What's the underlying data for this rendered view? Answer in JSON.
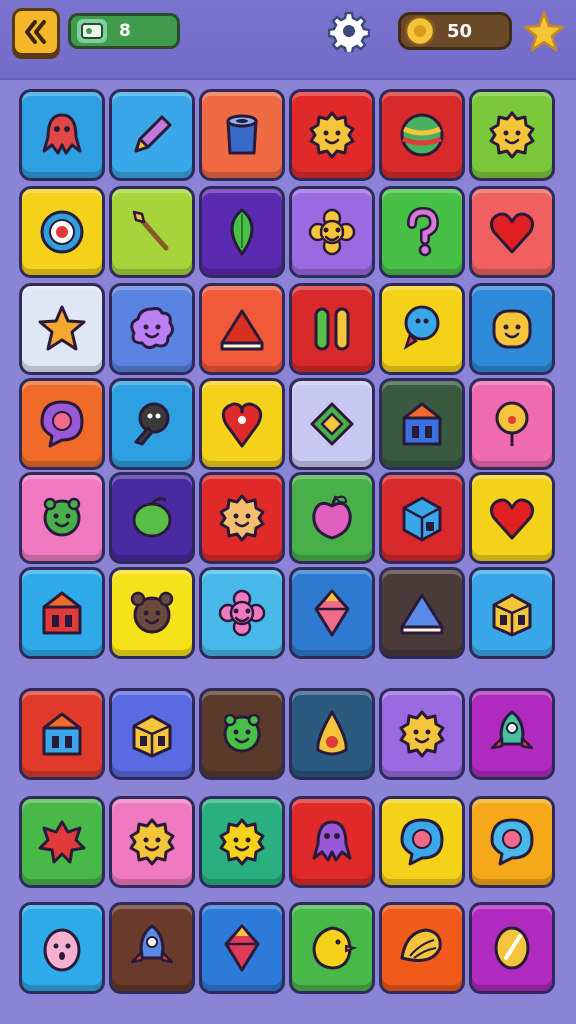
{
  "hud": {
    "xp_value": "8",
    "coins_value": "50",
    "colors": {
      "back": "#f4b72a",
      "xp": "#3f9a4a",
      "coins": "#6b4a2a",
      "accent": "#f4c43a"
    }
  },
  "board": {
    "rows": [
      [
        {
          "color": "#2e9fe0",
          "icon": "octopus-icon",
          "fg": "#e04848"
        },
        {
          "color": "#3aa8e8",
          "icon": "pencil-icon",
          "fg": "#c07ad8"
        },
        {
          "color": "#f06a44",
          "icon": "barrel-icon",
          "fg": "#3a6ac8"
        },
        {
          "color": "#e02a2a",
          "icon": "sun-face-icon",
          "fg": "#f4c43a"
        },
        {
          "color": "#d82a2a",
          "icon": "ball-icon",
          "fg": "#48b060"
        },
        {
          "color": "#7ac83a",
          "icon": "sun-face-icon",
          "fg": "#f4c43a"
        }
      ],
      [
        {
          "color": "#f4d21a",
          "icon": "target-icon",
          "fg": "#2e9fe0"
        },
        {
          "color": "#a6d43a",
          "icon": "brush-icon",
          "fg": "#8a5a2a"
        },
        {
          "color": "#5a2ab0",
          "icon": "leaf-icon",
          "fg": "#48c048"
        },
        {
          "color": "#9a6ae0",
          "icon": "flower-icon",
          "fg": "#f4c43a"
        },
        {
          "color": "#48c048",
          "icon": "question-icon",
          "fg": "#d878d8"
        },
        {
          "color": "#f06060",
          "icon": "heart-icon",
          "fg": "#e02020"
        }
      ],
      [
        {
          "color": "#dfe6f4",
          "icon": "star-icon",
          "fg": "#f4a830"
        },
        {
          "color": "#5a82e0",
          "icon": "blob-face-icon",
          "fg": "#b880f0"
        },
        {
          "color": "#f05a3a",
          "icon": "cheese-icon",
          "fg": "#d83020"
        },
        {
          "color": "#d82a2a",
          "icon": "pause-icon",
          "fg": "#58c048"
        },
        {
          "color": "#f4d21a",
          "icon": "ghost-icon",
          "fg": "#3aa8e8"
        },
        {
          "color": "#2e8ad8",
          "icon": "cookie-face-icon",
          "fg": "#f4c43a"
        }
      ],
      [
        {
          "color": "#f06a2a",
          "icon": "bubble-icon",
          "fg": "#9a5ad8"
        },
        {
          "color": "#2e9fe0",
          "icon": "keyhole-icon",
          "fg": "#3a3a3a"
        },
        {
          "color": "#f4d21a",
          "icon": "pin-icon",
          "fg": "#e02a2a"
        },
        {
          "color": "#c8c8f0",
          "icon": "frame-icon",
          "fg": "#48b048"
        },
        {
          "color": "#3a5a40",
          "icon": "house-icon",
          "fg": "#3a70e0"
        },
        {
          "color": "#f06ab0",
          "icon": "balloon-icon",
          "fg": "#f4c43a"
        }
      ],
      [
        {
          "color": "#f07ac0",
          "icon": "frog-icon",
          "fg": "#48b048"
        },
        {
          "color": "#4a2aa0",
          "icon": "lime-icon",
          "fg": "#58c048"
        },
        {
          "color": "#e02a2a",
          "icon": "sun-face-icon",
          "fg": "#f4c070"
        },
        {
          "color": "#48b048",
          "icon": "apple-icon",
          "fg": "#e060c0"
        },
        {
          "color": "#d82a2a",
          "icon": "cube-icon",
          "fg": "#3aa8e8"
        },
        {
          "color": "#f4d21a",
          "icon": "heart-icon",
          "fg": "#e02020"
        }
      ],
      [
        {
          "color": "#2eaae8",
          "icon": "house-icon",
          "fg": "#e03a3a"
        },
        {
          "color": "#f4e21a",
          "icon": "bear-icon",
          "fg": "#6a4a3a"
        },
        {
          "color": "#48b8e8",
          "icon": "flower-icon",
          "fg": "#f07ac0"
        },
        {
          "color": "#2e7ad0",
          "icon": "gem-icon",
          "fg": "#f06a8a"
        },
        {
          "color": "#4a3a3a",
          "icon": "cheese-icon",
          "fg": "#5a8ae8"
        },
        {
          "color": "#3aa8e8",
          "icon": "box-icon",
          "fg": "#f4c43a"
        }
      ],
      [
        {
          "color": "#e03a2a",
          "icon": "house-icon",
          "fg": "#3aa8e8"
        },
        {
          "color": "#5a6ae0",
          "icon": "box-icon",
          "fg": "#f4c43a"
        },
        {
          "color": "#5a3a2a",
          "icon": "frog-icon",
          "fg": "#48c048"
        },
        {
          "color": "#2a5a80",
          "icon": "cone-icon",
          "fg": "#f4c43a"
        },
        {
          "color": "#9a6ae0",
          "icon": "sun-face-icon",
          "fg": "#f4c43a"
        },
        {
          "color": "#b02ac0",
          "icon": "rocket-icon",
          "fg": "#48c0a0"
        }
      ],
      [
        {
          "color": "#48b848",
          "icon": "splat-icon",
          "fg": "#e03a3a"
        },
        {
          "color": "#f07ac0",
          "icon": "sun-face-icon",
          "fg": "#f4c43a"
        },
        {
          "color": "#2ab080",
          "icon": "sun-face-icon",
          "fg": "#f4d21a"
        },
        {
          "color": "#e02a2a",
          "icon": "octopus-icon",
          "fg": "#9a5ad8"
        },
        {
          "color": "#f4d21a",
          "icon": "bubble-icon",
          "fg": "#3aa8e8"
        },
        {
          "color": "#f4a81a",
          "icon": "bubble-icon",
          "fg": "#48b8e8"
        }
      ],
      [
        {
          "color": "#2eaae8",
          "icon": "egg-face-icon",
          "fg": "#f4b0d0"
        },
        {
          "color": "#6a3a2a",
          "icon": "rocket-icon",
          "fg": "#5a8ae8"
        },
        {
          "color": "#2e7ad8",
          "icon": "gem-icon",
          "fg": "#e03a5a"
        },
        {
          "color": "#48b848",
          "icon": "chick-icon",
          "fg": "#f4d21a"
        },
        {
          "color": "#f05a1a",
          "icon": "shell-icon",
          "fg": "#f4c43a"
        },
        {
          "color": "#b02ac0",
          "icon": "lemon-icon",
          "fg": "#f4c43a"
        }
      ]
    ]
  }
}
